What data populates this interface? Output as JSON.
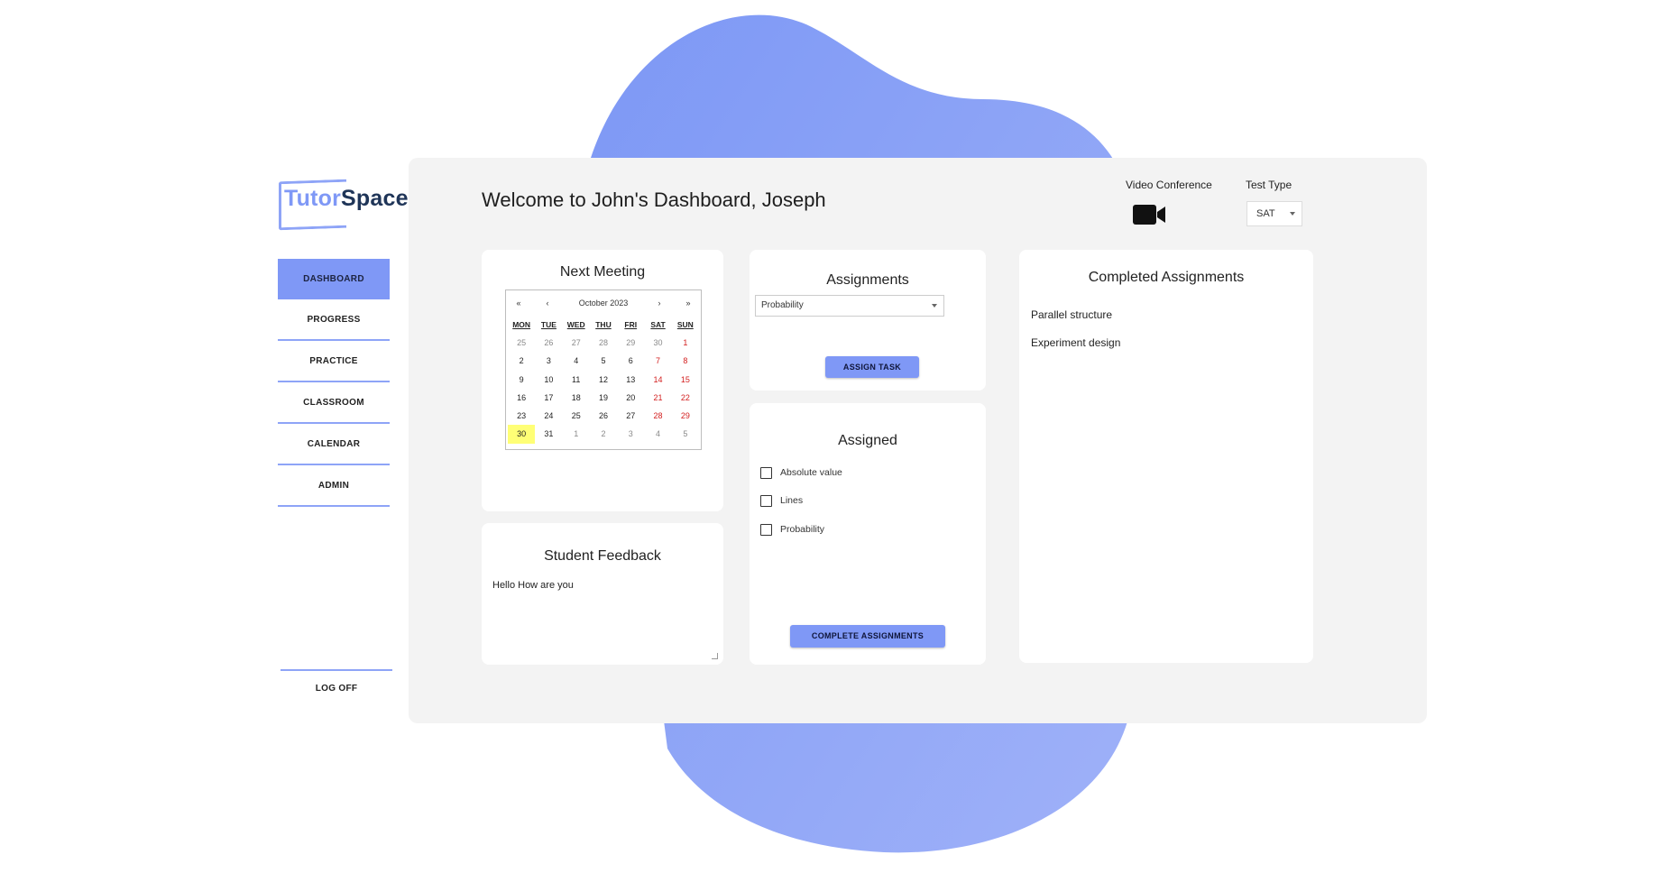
{
  "brand": {
    "part1": "Tutor",
    "part2": "Space"
  },
  "colors": {
    "accent": "#7f98f6",
    "blob": "#8ea4f7",
    "weekend": "#d31f1f",
    "today": "#ffff76",
    "panel": "#f3f3f3"
  },
  "sidebar": {
    "items": [
      {
        "label": "DASHBOARD",
        "active": true
      },
      {
        "label": "PROGRESS"
      },
      {
        "label": "PRACTICE"
      },
      {
        "label": "CLASSROOM"
      },
      {
        "label": "CALENDAR"
      },
      {
        "label": "ADMIN"
      }
    ],
    "logoff": "LOG OFF"
  },
  "header": {
    "welcome": "Welcome to John's Dashboard, Joseph",
    "video_label": "Video Conference",
    "video_icon": "video-camera-icon",
    "test_type_label": "Test Type",
    "test_type_value": "SAT"
  },
  "next_meeting": {
    "title": "Next Meeting",
    "calendar": {
      "month": "October 2023",
      "nav": {
        "prev_year": "«",
        "prev": "‹",
        "next": "›",
        "next_year": "»"
      },
      "weekdays": [
        "MON",
        "TUE",
        "WED",
        "THU",
        "FRI",
        "SAT",
        "SUN"
      ],
      "weeks": [
        [
          "25",
          "26",
          "27",
          "28",
          "29",
          "30",
          "1"
        ],
        [
          "2",
          "3",
          "4",
          "5",
          "6",
          "7",
          "8"
        ],
        [
          "9",
          "10",
          "11",
          "12",
          "13",
          "14",
          "15"
        ],
        [
          "16",
          "17",
          "18",
          "19",
          "20",
          "21",
          "22"
        ],
        [
          "23",
          "24",
          "25",
          "26",
          "27",
          "28",
          "29"
        ],
        [
          "30",
          "31",
          "1",
          "2",
          "3",
          "4",
          "5"
        ]
      ],
      "selected": "30"
    }
  },
  "student_feedback": {
    "title": "Student Feedback",
    "text": "Hello How are you"
  },
  "assignments": {
    "title": "Assignments",
    "selected": "Probability",
    "assign_button": "ASSIGN TASK"
  },
  "assigned": {
    "title": "Assigned",
    "items": [
      "Absolute value",
      "Lines",
      "Probability"
    ],
    "complete_button": "COMPLETE ASSIGNMENTS"
  },
  "completed": {
    "title": "Completed Assignments",
    "items": [
      "Parallel structure",
      "Experiment design"
    ]
  }
}
